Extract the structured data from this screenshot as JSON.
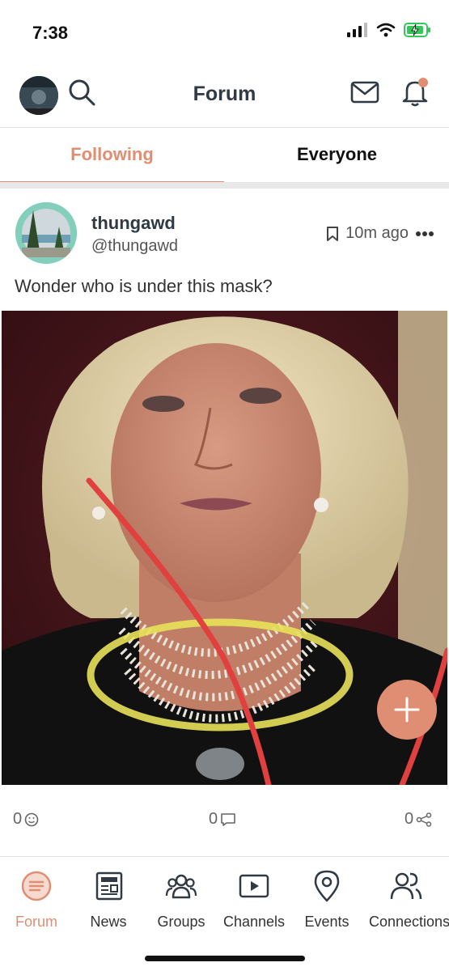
{
  "status_bar": {
    "time": "7:38"
  },
  "header": {
    "title": "Forum"
  },
  "tabs": [
    {
      "label": "Following",
      "active": true
    },
    {
      "label": "Everyone",
      "active": false
    }
  ],
  "post": {
    "display_name": "thungawd",
    "handle": "@thungawd",
    "time_ago": "10m ago",
    "text": "Wonder who is under this mask?",
    "likes": "0",
    "comments": "0",
    "shares": "0"
  },
  "bottom_nav": [
    {
      "label": "Forum",
      "icon": "forum-icon",
      "active": true
    },
    {
      "label": "News",
      "icon": "news-icon",
      "active": false
    },
    {
      "label": "Groups",
      "icon": "groups-icon",
      "active": false
    },
    {
      "label": "Channels",
      "icon": "channels-icon",
      "active": false
    },
    {
      "label": "Events",
      "icon": "events-icon",
      "active": false
    },
    {
      "label": "Connections",
      "icon": "connections-icon",
      "active": false
    }
  ],
  "colors": {
    "accent": "#e08e73",
    "title": "#2f3a45"
  }
}
